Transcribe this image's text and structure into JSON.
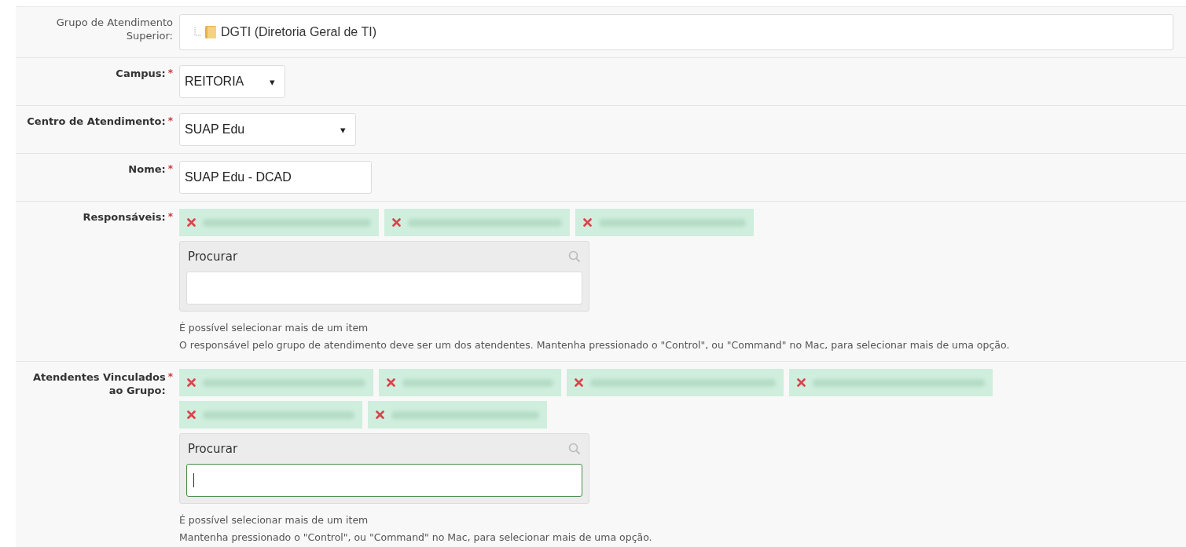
{
  "fields": [
    {
      "kind": "tree",
      "label": "Grupo de Atendimento Superior:",
      "value": "DGTI (Diretoria Geral de TI)"
    },
    {
      "kind": "select",
      "label": "Campus:",
      "required_mark": "*",
      "value": "REITORIA",
      "arrow": "▾"
    },
    {
      "kind": "select",
      "label": "Centro de Atendimento:",
      "required_mark": "*",
      "value": "SUAP Edu",
      "arrow": "▾"
    },
    {
      "kind": "text",
      "label": "Nome:",
      "required_mark": "*",
      "value": "SUAP Edu - DCAD"
    },
    {
      "kind": "multi",
      "label": "Responsáveis:",
      "required_mark": "*",
      "chips": [
        {
          "kind": "redacted"
        },
        {
          "kind": "redacted"
        },
        {
          "kind": "redacted"
        }
      ],
      "search": {
        "title": "Procurar",
        "focused": false
      },
      "help": [
        "É possível selecionar mais de um item",
        "O responsável pelo grupo de atendimento deve ser um dos atendentes. Mantenha pressionado o \"Control\", ou \"Command\" no Mac, para selecionar mais de uma opção."
      ]
    },
    {
      "kind": "multi",
      "label": "Atendentes Vinculados ao Grupo:",
      "required_mark": "*",
      "chips": [
        {
          "kind": "redacted"
        },
        {
          "kind": "redacted"
        },
        {
          "kind": "redacted"
        },
        {
          "kind": "redacted"
        },
        {
          "kind": "redacted"
        },
        {
          "kind": "redacted"
        }
      ],
      "search": {
        "title": "Procurar",
        "focused": true
      },
      "help": [
        "É possível selecionar mais de um item",
        "Mantenha pressionado o \"Control\", ou \"Command\" no Mac, para selecionar mais de uma opção."
      ]
    }
  ]
}
